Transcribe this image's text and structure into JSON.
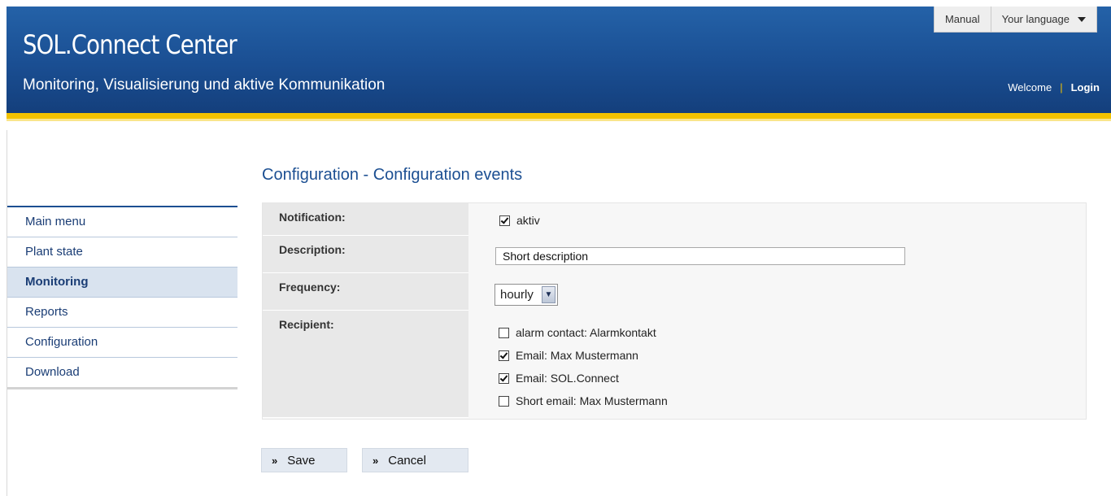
{
  "header": {
    "title": "SOL.Connect Center",
    "subtitle": "Monitoring, Visualisierung und aktive Kommunikation",
    "manual_label": "Manual",
    "language_label": "Your language",
    "welcome_label": "Welcome",
    "separator": "|",
    "login_label": "Login",
    "colors": {
      "header_blue": "#1a4e92",
      "accent_gold": "#f2c200"
    }
  },
  "sidebar": {
    "items": [
      {
        "label": "Main menu",
        "active": false
      },
      {
        "label": "Plant state",
        "active": false
      },
      {
        "label": "Monitoring",
        "active": true
      },
      {
        "label": "Reports",
        "active": false
      },
      {
        "label": "Configuration",
        "active": false
      },
      {
        "label": "Download",
        "active": false
      }
    ]
  },
  "page_title": "Configuration - Configuration events",
  "form": {
    "notification": {
      "label": "Notification:",
      "checkbox_label": "aktiv",
      "checked": true
    },
    "description": {
      "label": "Description:",
      "value": "Short description"
    },
    "frequency": {
      "label": "Frequency:",
      "selected": "hourly"
    },
    "recipient": {
      "label": "Recipient:",
      "options": [
        {
          "label": "alarm contact: Alarmkontakt",
          "checked": false
        },
        {
          "label": "Email: Max Mustermann",
          "checked": true
        },
        {
          "label": "Email: SOL.Connect",
          "checked": true
        },
        {
          "label": "Short email: Max Mustermann",
          "checked": false
        }
      ]
    }
  },
  "buttons": {
    "arrow": "»",
    "save_label": "Save",
    "cancel_label": "Cancel"
  }
}
